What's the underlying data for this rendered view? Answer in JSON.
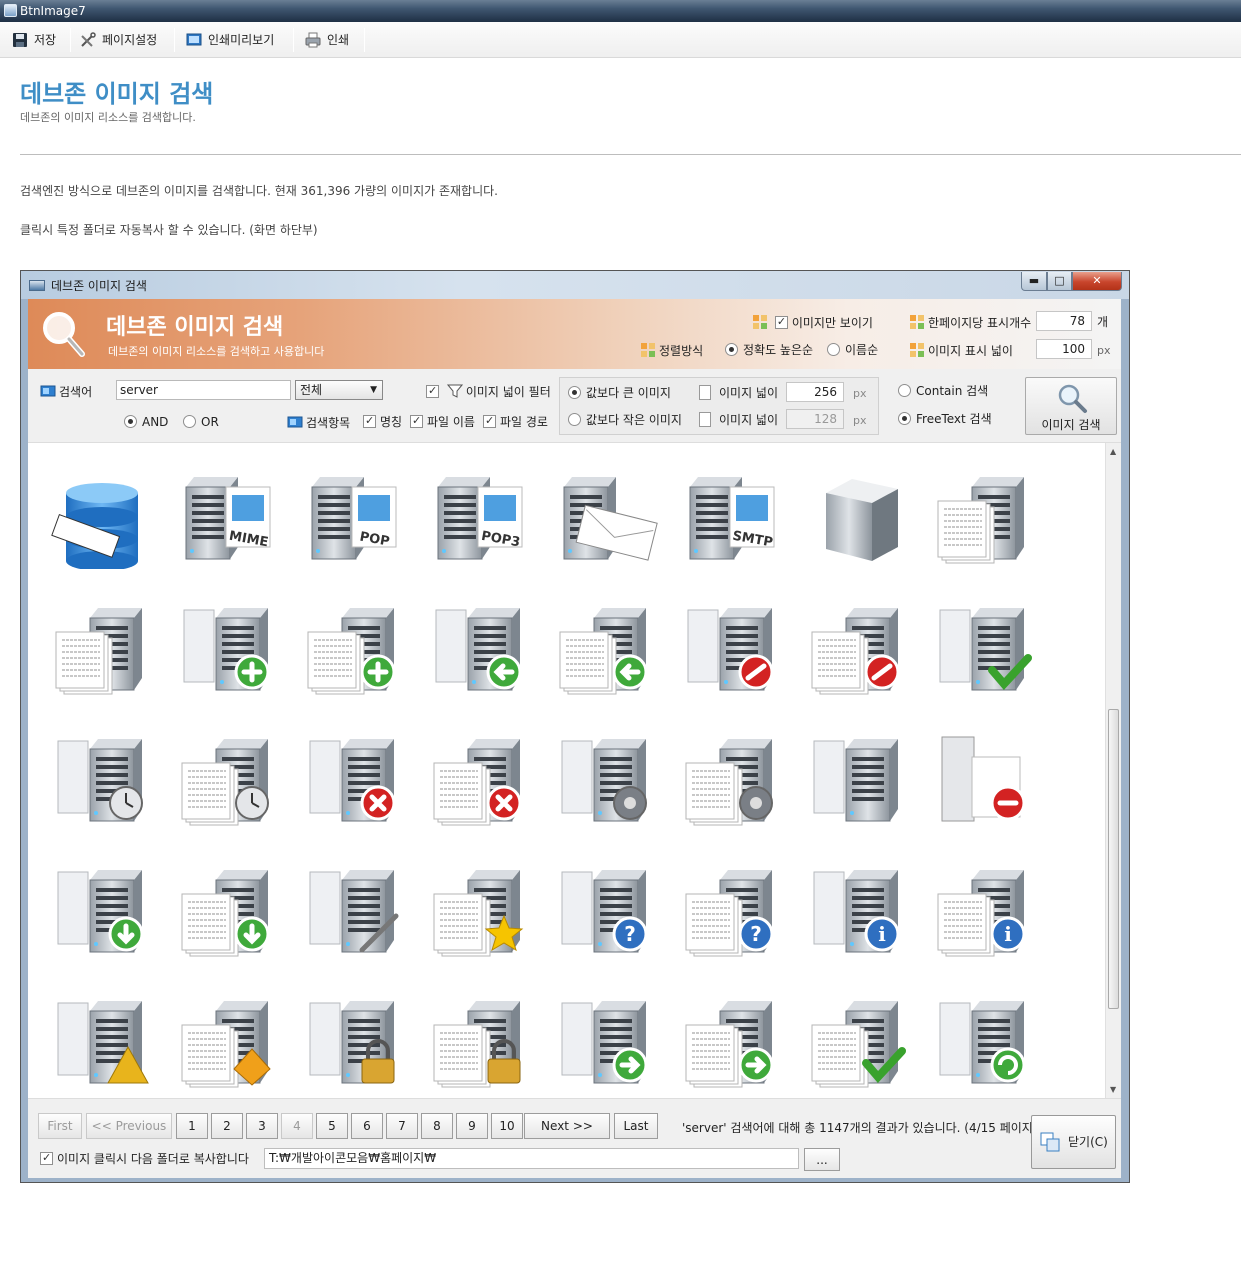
{
  "app": {
    "title": "BtnImage7",
    "toolbar": {
      "save": "저장",
      "page_setup": "페이지설정",
      "print_preview": "인쇄미리보기",
      "print": "인쇄"
    }
  },
  "page": {
    "title": "데브존 이미지 검색",
    "subtitle": "데브존의 이미지 리소스를 검색합니다.",
    "desc1": "검색엔진 방식으로 데브존의 이미지를 검색합니다. 현재 361,396 가량의 이미지가 존재합니다.",
    "desc2": "클릭시 특정 폴더로 자동복사 할 수 있습니다. (화면 하단부)"
  },
  "window": {
    "title": "데브존 이미지 검색",
    "min_icon": "minimize-icon",
    "max_icon": "maximize-icon",
    "close_icon": "close-icon"
  },
  "banner": {
    "title": "데브존 이미지 검색",
    "subtitle": "데브존의 이미지 리소스를 검색하고 사용합니다",
    "images_only": "이미지만 보이기",
    "sort_label": "정렬방식",
    "sort_accuracy": "정확도 높은순",
    "sort_name": "이름순",
    "per_page_label": "한페이지당 표시개수",
    "per_page_value": "78",
    "per_page_unit": "개",
    "display_width_label": "이미지 표시 넓이",
    "display_width_value": "100",
    "display_width_unit": "px"
  },
  "search": {
    "keyword_label": "검색어",
    "keyword_value": "server",
    "scope_value": "전체",
    "and_label": "AND",
    "or_label": "OR",
    "width_filter_label": "이미지 넓이 필터",
    "fields_label": "검색항목",
    "field_name": "명칭",
    "field_filename": "파일 이름",
    "field_path": "파일 경로",
    "larger_label": "값보다 큰 이미지",
    "smaller_label": "값보다 작은 이미지",
    "width_label": "이미지 넓이",
    "width_value_1": "256",
    "width_value_2": "128",
    "px": "px",
    "contain_label": "Contain 검색",
    "freetext_label": "FreeText 검색",
    "search_button": "이미지 검색"
  },
  "icons": [
    [
      "sql-server-db-icon",
      "server-mime-icon",
      "server-pop-icon",
      "server-pop3-icon",
      "server-mail-icon",
      "server-smtp-icon",
      "server-tower-icon",
      "server-documents-icon"
    ],
    [
      "server-documents-2-icon",
      "server-add-icon",
      "server-documents-add-icon",
      "server-back-icon",
      "server-documents-back-icon",
      "server-edit-icon",
      "server-documents-edit-icon",
      "server-check-icon"
    ],
    [
      "server-clock-icon",
      "server-documents-clock-icon",
      "server-remove-icon",
      "server-documents-remove-icon",
      "server-gear-icon",
      "server-documents-gear-icon",
      "server-minus-icon",
      "server-document-minus-icon"
    ],
    [
      "server-download-icon",
      "server-documents-download-icon",
      "server-pen-icon",
      "server-documents-star-icon",
      "server-help-icon",
      "server-documents-help-icon",
      "server-info-icon",
      "server-documents-info-icon"
    ],
    [
      "server-pyramid-icon",
      "server-documents-shape-icon",
      "server-lock-icon",
      "server-documents-lock-icon",
      "server-forward-icon",
      "server-documents-forward-icon",
      "server-documents-check-icon",
      "server-refresh-icon"
    ]
  ],
  "pager": {
    "first": "First",
    "previous": "<< Previous",
    "pages": [
      "1",
      "2",
      "3",
      "4",
      "5",
      "6",
      "7",
      "8",
      "9",
      "10"
    ],
    "next": "Next >>",
    "last": "Last",
    "result": "'server' 검색어에 대해 총 1147개의 결과가 있습니다. (4/15 페이지)",
    "close": "닫기(C)",
    "copy_label": "이미지 클릭시 다음 폴더로 복사합니다",
    "copy_path": "T:₩개발아이콘모음₩홈페이지₩",
    "browse": "..."
  },
  "colors": {
    "accent": "#3f8ec6",
    "banner": "#de8a58"
  }
}
